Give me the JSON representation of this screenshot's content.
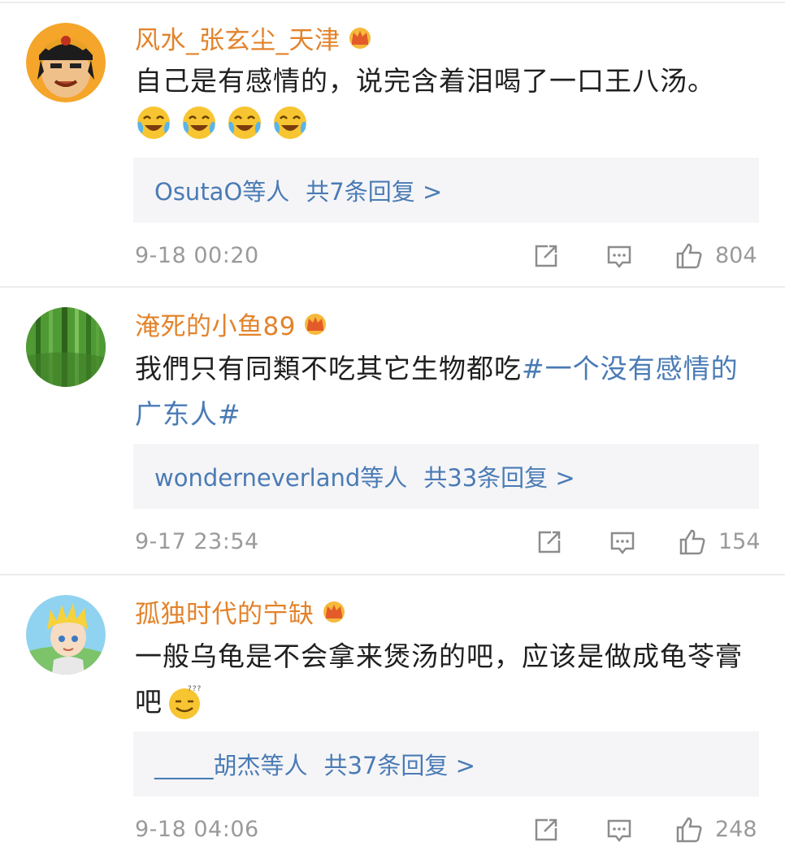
{
  "comments": [
    {
      "username": "风水_张玄尘_天津",
      "text_lines": [
        "自己是有感情的，说完含着泪喝了一口王八汤。"
      ],
      "emojis": [
        "laugh-cry-icon",
        "laugh-cry-icon",
        "laugh-cry-icon",
        "laugh-cry-icon"
      ],
      "replies_users": "OsutaO等人",
      "replies_count": "共7条回复 >",
      "time": "9-18 00:20",
      "likes": "804"
    },
    {
      "username": "淹死的小鱼89",
      "text_line1_plain": "我們只有同類不吃其它生物都吃",
      "text_line1_tag": "#一个没有感情的",
      "text_line2_tag": "广东人#",
      "replies_users": "wonderneverland等人",
      "replies_count": "共33条回复 >",
      "time": "9-17 23:54",
      "likes": "154"
    },
    {
      "username": "孤独时代的宁缺",
      "text_lines": [
        "一般乌龟是不会拿来煲汤的吧，应该是做成龟苓膏",
        "吧"
      ],
      "emoji_inline": "sweat-smile-icon",
      "replies_users": "_____胡杰等人",
      "replies_count": "共37条回复 >",
      "time": "9-18 04:06",
      "likes": "248"
    }
  ],
  "colors": {
    "username": "#e3832b",
    "link": "#4a7bb5",
    "meta": "#9a9a9a",
    "reply_bg": "#f5f5f7"
  }
}
